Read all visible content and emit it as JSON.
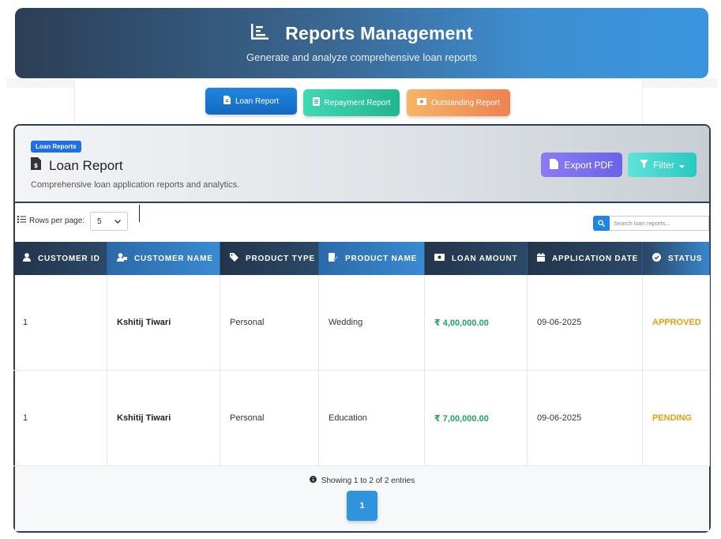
{
  "header": {
    "icon": "chart-bar-icon",
    "title": "Reports Management",
    "subtitle": "Generate and analyze comprehensive loan reports"
  },
  "tabs": [
    {
      "label": "Loan Report",
      "icon": "file-icon",
      "active": true
    },
    {
      "label": "Repayment Report",
      "icon": "document-icon"
    },
    {
      "label": "Outstanding Report",
      "icon": "money-icon"
    }
  ],
  "card": {
    "badge": "Loan Reports",
    "title": "Loan Report",
    "description": "Comprehensive loan application reports and analytics.",
    "export_label": "Export PDF",
    "filter_label": "Filter"
  },
  "toolbar": {
    "rows_label": "Rows per page:",
    "rows_value": "5",
    "search_placeholder": "Search loan reports..."
  },
  "table": {
    "columns": [
      "CUSTOMER ID",
      "CUSTOMER NAME",
      "PRODUCT TYPE",
      "PRODUCT NAME",
      "LOAN AMOUNT",
      "APPLICATION DATE",
      "STATUS"
    ],
    "rows": [
      [
        "1",
        "Kshitij Tiwari",
        "Personal",
        "Wedding",
        "₹ 4,00,000.00",
        "09-06-2025",
        "APPROVED"
      ],
      [
        "1",
        "Kshitij Tiwari",
        "Personal",
        "Education",
        "₹ 7,00,000.00",
        "09-06-2025",
        "PENDING"
      ]
    ]
  },
  "footer": {
    "showing": "Showing 1 to 2 of 2 entries",
    "page": "1"
  },
  "colors": {
    "accent": "#1f86e0",
    "amount": "#1fa65a",
    "status": "#e79e12"
  }
}
